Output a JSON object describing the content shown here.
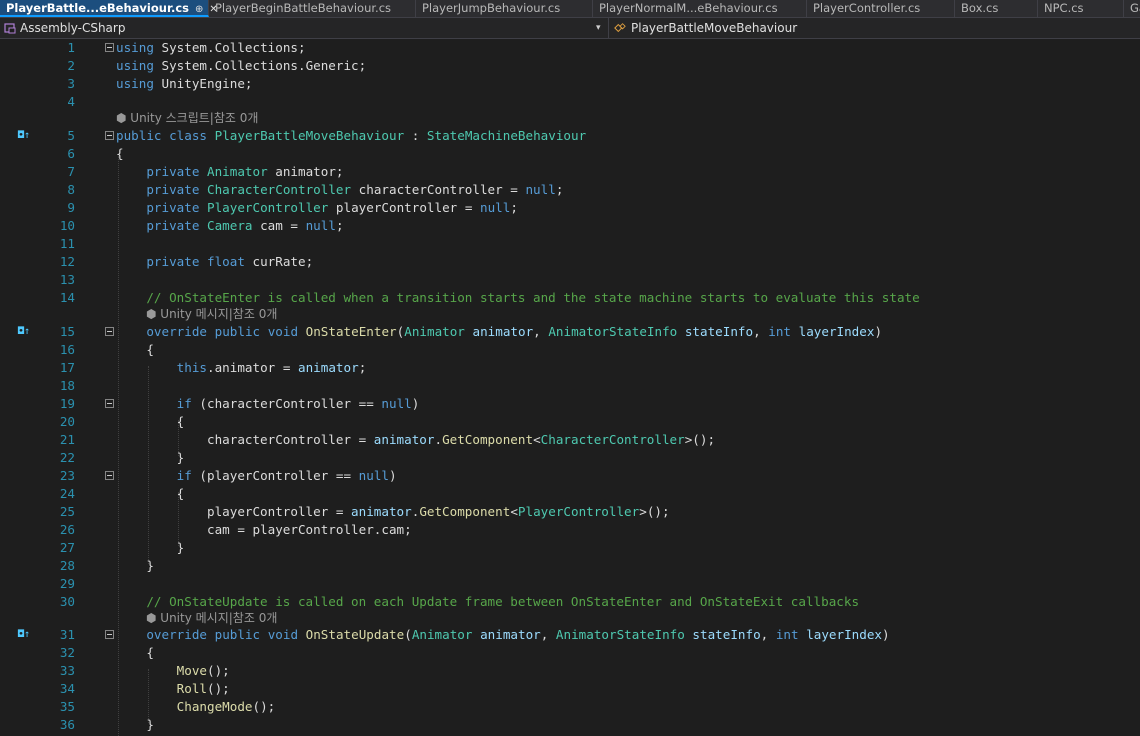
{
  "tabs": [
    {
      "label": "PlayerBattle...eBehaviour.cs",
      "active": true,
      "pin": "⊕",
      "close": "✕"
    },
    {
      "label": "PlayerBeginBattleBehaviour.cs"
    },
    {
      "label": "PlayerJumpBehaviour.cs"
    },
    {
      "label": "PlayerNormalM...eBehaviour.cs"
    },
    {
      "label": "PlayerController.cs"
    },
    {
      "label": "Box.cs"
    },
    {
      "label": "NPC.cs"
    },
    {
      "label": "Ga"
    }
  ],
  "navbar": {
    "project": "Assembly-CSharp",
    "member": "PlayerBattleMoveBehaviour",
    "dropdown_arrow": "▾"
  },
  "lens_unity_script": "⬢ Unity 스크립트|참조 0개",
  "lens_unity_message": "⬢ Unity 메시지|참조 0개",
  "code_lines": {
    "l1": "using System.Collections;",
    "l2": "using System.Collections.Generic;",
    "l3": "using UnityEngine;",
    "l5": "public class PlayerBattleMoveBehaviour : StateMachineBehaviour",
    "l6": "{",
    "l7": "    private Animator animator;",
    "l8": "    private CharacterController characterController = null;",
    "l9": "    private PlayerController playerController = null;",
    "l10": "    private Camera cam = null;",
    "l12": "    private float curRate;",
    "l14": "    // OnStateEnter is called when a transition starts and the state machine starts to evaluate this state",
    "l15": "    override public void OnStateEnter(Animator animator, AnimatorStateInfo stateInfo, int layerIndex)",
    "l16": "    {",
    "l17": "        this.animator = animator;",
    "l19": "        if (characterController == null)",
    "l20": "        {",
    "l21": "            characterController = animator.GetComponent<CharacterController>();",
    "l22": "        }",
    "l23": "        if (playerController == null)",
    "l24": "        {",
    "l25": "            playerController = animator.GetComponent<PlayerController>();",
    "l26": "            cam = playerController.cam;",
    "l27": "        }",
    "l28": "    }",
    "l30": "    // OnStateUpdate is called on each Update frame between OnStateEnter and OnStateExit callbacks",
    "l31": "    override public void OnStateUpdate(Animator animator, AnimatorStateInfo stateInfo, int layerIndex)",
    "l32": "    {",
    "l33": "        Move();",
    "l34": "        Roll();",
    "l35": "        ChangeMode();",
    "l36": "    }"
  },
  "line_numbers": [
    "1",
    "2",
    "3",
    "4",
    "5",
    "6",
    "7",
    "8",
    "9",
    "10",
    "11",
    "12",
    "13",
    "14",
    "15",
    "16",
    "17",
    "18",
    "19",
    "20",
    "21",
    "22",
    "23",
    "24",
    "25",
    "26",
    "27",
    "28",
    "29",
    "30",
    "31",
    "32",
    "33",
    "34",
    "35",
    "36"
  ],
  "margin_glyph": "◘↑",
  "colors": {
    "background": "#1e1e1e",
    "keyword": "#569cd6",
    "type": "#4ec9b0",
    "comment": "#57a64a",
    "method": "#dcdcaa",
    "variable": "#9cdcfe",
    "line_number": "#2b91af",
    "active_tab": "#1c4e7e"
  }
}
